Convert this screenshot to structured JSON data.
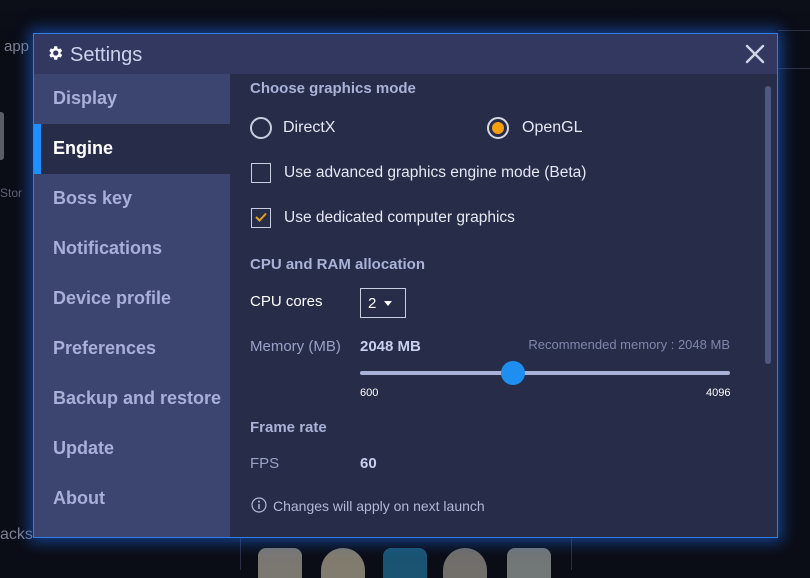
{
  "background": {
    "app_text": "app",
    "store_text": "Stor",
    "packs_text": "acks"
  },
  "dialog": {
    "title": "Settings",
    "title_icon": "gear-icon",
    "close_icon": "close-icon"
  },
  "sidebar": {
    "active_index": 1,
    "items": [
      {
        "label": "Display"
      },
      {
        "label": "Engine"
      },
      {
        "label": "Boss key"
      },
      {
        "label": "Notifications"
      },
      {
        "label": "Device profile"
      },
      {
        "label": "Preferences"
      },
      {
        "label": "Backup and restore"
      },
      {
        "label": "Update"
      },
      {
        "label": "About"
      }
    ]
  },
  "engine": {
    "graphics_mode": {
      "title": "Choose graphics mode",
      "options": [
        {
          "label": "DirectX",
          "selected": false
        },
        {
          "label": "OpenGL",
          "selected": true
        }
      ]
    },
    "checkboxes": [
      {
        "label": "Use advanced graphics engine mode (Beta)",
        "checked": false
      },
      {
        "label": "Use dedicated computer graphics",
        "checked": true
      }
    ],
    "cpu_ram": {
      "title": "CPU and RAM allocation",
      "cpu_label": "CPU cores",
      "cpu_value": "2",
      "memory_label": "Memory (MB)",
      "memory_value": "2048 MB",
      "recommended": "Recommended memory : 2048 MB",
      "slider": {
        "min": 600,
        "max": 4096,
        "value": 2048,
        "min_label": "600",
        "max_label": "4096"
      }
    },
    "frame_rate": {
      "title": "Frame rate",
      "fps_label": "FPS",
      "fps_value": "60"
    },
    "notice": "Changes will apply on next launch"
  },
  "colors": {
    "accent": "#1e90ff",
    "radio_selected": "#f5a00a",
    "checkmark": "#e0a020",
    "sidebar_bg": "#3c4470",
    "content_bg": "#272c48",
    "title_bg": "#323860"
  }
}
